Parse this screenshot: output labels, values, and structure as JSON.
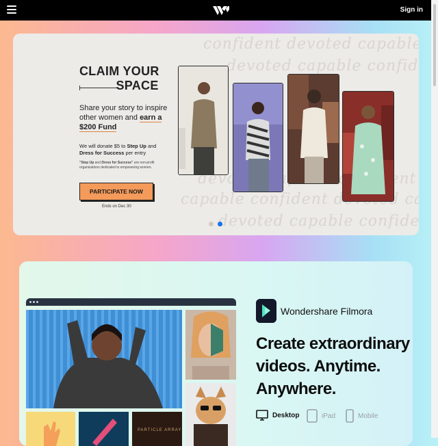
{
  "header": {
    "sign_in": "Sign in"
  },
  "banner": {
    "title_line1": "CLAIM YOUR",
    "title_line2": "SPACE",
    "share_line": "Share your story to inspire other women and",
    "share_highlight": "earn a $200 Fund",
    "donate_prefix": "We will donate $5 to",
    "donate_org1": "Step Up",
    "donate_and": "and",
    "donate_org2": "Dress for Success",
    "donate_suffix": "per entry",
    "note_org1": "\"Step Up",
    "note_and": "and",
    "note_org2": "Dress for Success\"",
    "note_rest": "are non-profit organizations dedicated to empowering women.",
    "cta": "PARTICIPATE NOW",
    "ends": "Ends on Dec 30",
    "script_words": [
      "confident  devoted  capable",
      "devoted  capable  confident",
      "devoted  capable  confident",
      "capable  confident  devoted  ca",
      "devoted  capable  confident"
    ],
    "active_slide": 2,
    "colors": {
      "accent": "#f49a5a",
      "active_dot": "#1a73e8"
    }
  },
  "product": {
    "app_name": "Wondershare Filmora",
    "headline": "Create extraordinary videos. Anytime. Anywhere.",
    "devices": [
      {
        "label": "Desktop",
        "icon": "desktop-icon",
        "active": true
      },
      {
        "label": "iPad",
        "icon": "tablet-icon",
        "active": false
      },
      {
        "label": "Mobile",
        "icon": "mobile-icon",
        "active": false
      }
    ],
    "tile_text": "PARTICLE ARRAY"
  }
}
